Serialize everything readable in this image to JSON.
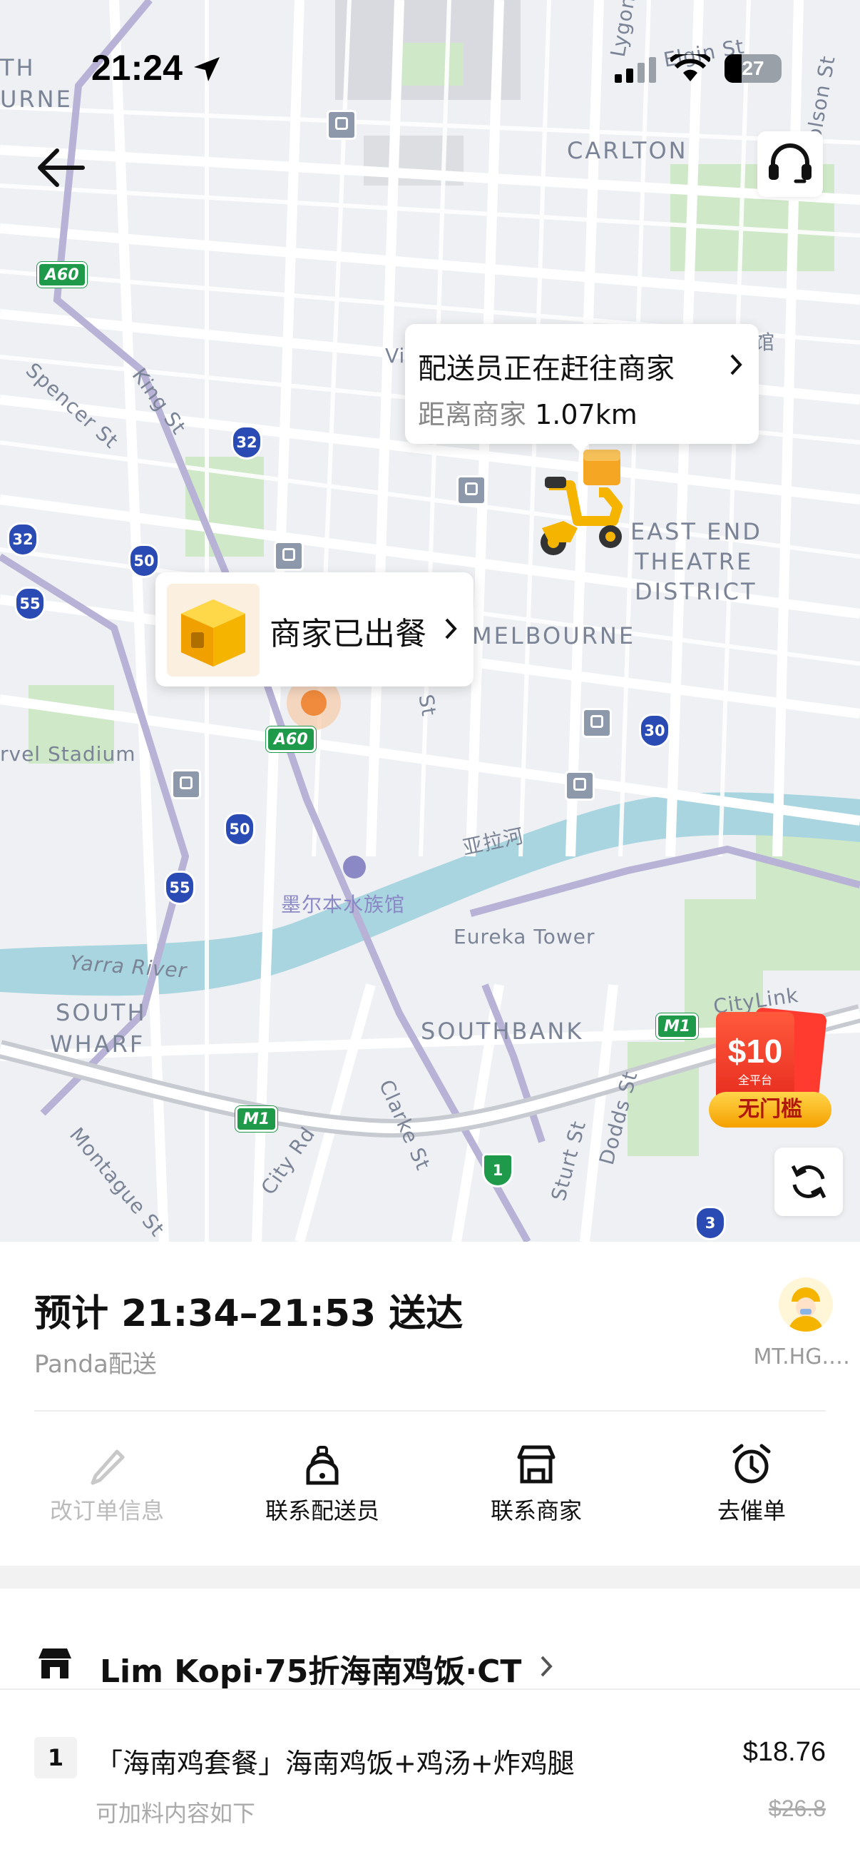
{
  "status_bar": {
    "time": "21:24",
    "battery": "27"
  },
  "map": {
    "labels": {
      "carlton": "CARLTON",
      "east_end_1": "EAST END",
      "east_end_2": "THEATRE",
      "east_end_3": "DISTRICT",
      "melbourne": "MELBOURNE",
      "southbank": "SOUTHBANK",
      "south_wharf_1": "SOUTH",
      "south_wharf_2": "WHARF",
      "north_melbourne_1": "TH",
      "north_melbourne_2": "URNE",
      "stadium": "rvel Stadium",
      "yarra_river": "Yarra River",
      "yarra_cn": "亚拉河",
      "aquarium": "墨尔本水族馆",
      "eureka": "Eureka Tower",
      "spencer": "Spencer St",
      "king": "King St",
      "clarke": "Clarke St",
      "city_rd": "City Rd",
      "montague": "Montague St",
      "sturt": "Sturt St",
      "dodds": "Dodds St",
      "elgin": "Elgin St",
      "lygon": "Lygon",
      "nicholson": "holson St",
      "citylink": "CityLink",
      "vic": "Vi",
      "guan": "馆",
      "st": "St"
    },
    "shields": [
      "A60",
      "A60",
      "M1",
      "M1"
    ],
    "routes": [
      "32",
      "32",
      "50",
      "55",
      "50",
      "55",
      "30",
      "3",
      "1"
    ]
  },
  "rider_bubble": {
    "title": "配送员正在赶往商家",
    "distance_label": "距离商家",
    "distance_value": "1.07km"
  },
  "merchant_bubble": {
    "title": "商家已出餐"
  },
  "promo": {
    "amount": "$10",
    "small": "全平台",
    "label": "无门槛"
  },
  "delivery": {
    "eta": "预计 21:34–21:53 送达",
    "provider": "Panda配送",
    "rider_name": "MT.HG.…"
  },
  "actions": [
    {
      "label": "改订单信息",
      "icon": "pencil-icon",
      "enabled": false
    },
    {
      "label": "联系配送员",
      "icon": "rider-icon",
      "enabled": true
    },
    {
      "label": "联系商家",
      "icon": "store-icon",
      "enabled": true
    },
    {
      "label": "去催单",
      "icon": "alarm-clock-icon",
      "enabled": true
    }
  ],
  "order": {
    "store_name": "Lim Kopi·75折海南鸡饭·CT",
    "item_qty": "1",
    "item_name": "「海南鸡套餐」海南鸡饭+鸡汤+炸鸡腿",
    "item_price": "$18.76",
    "item_original_price": "$26.8",
    "item_note": "可加料内容如下"
  },
  "colors": {
    "accent": "#f5b400",
    "route_blue": "#2b4bb4",
    "highway_green": "#1f9a4a",
    "water": "#a8d5df",
    "park": "#cfe8c8"
  }
}
